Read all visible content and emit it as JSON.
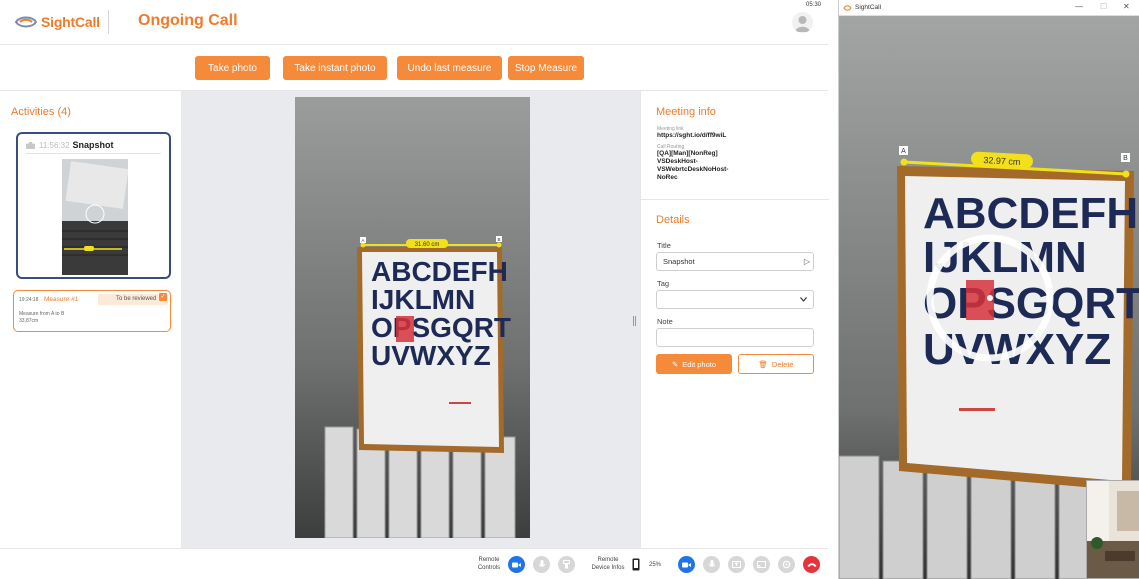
{
  "header": {
    "brand": "SightCall",
    "title": "Ongoing Call",
    "clock": "05:30"
  },
  "actions": {
    "take_photo": "Take photo",
    "take_instant_photo": "Take instant photo",
    "undo_last_measure": "Undo last measure",
    "stop_measure": "Stop Measure"
  },
  "activities": {
    "title": "Activities (4)",
    "snapshot": {
      "time": "11:56:32",
      "label": "Snapshot"
    },
    "measure": {
      "time": "19:24:18",
      "label": "Measure #1",
      "status": "To be reviewed",
      "description": "Measure from A to B",
      "value": "33,87cm"
    }
  },
  "photo": {
    "measure_label": "31.60 cm",
    "point_a": "A",
    "point_b": "B",
    "poster_lines": [
      "ABCDEFH",
      "IJKLMN",
      "OPSGQRT",
      "UVWXYZ"
    ]
  },
  "meeting_info": {
    "title": "Meeting info",
    "meeting_link_label": "Meeting link",
    "meeting_link": "https://sght.io/d/ff9wiL",
    "call_routing_label": "Call Routing",
    "call_routing_lines": [
      "[QA][Man][NonReg]",
      "VSDeskHost-",
      "VSWebrtcDeskNoHost-",
      "NoRec"
    ]
  },
  "details": {
    "title": "Details",
    "title_label": "Title",
    "title_value": "Snapshot",
    "tag_label": "Tag",
    "tag_value": "",
    "note_label": "Note",
    "note_value": "",
    "edit_button": "Edit photo",
    "delete_button": "Delete"
  },
  "bottom_bar": {
    "remote_controls": "Remote Controls",
    "remote_device_infos": "Remote Device Infos",
    "battery": "25%"
  },
  "remote_window": {
    "title": "SightCall",
    "measure_label": "32.97 cm",
    "point_a": "A",
    "point_b": "B",
    "poster_lines": [
      "ABCDEFH",
      "IJKLMN",
      "OPSGQRT",
      "UVWXYZ"
    ]
  },
  "colors": {
    "accent": "#f58a3a",
    "title_orange": "#f07b2b",
    "card_border": "#3a4c80",
    "call_blue": "#1e74e8",
    "hangup_red": "#e6343f",
    "measure_yellow": "#f2e11a",
    "poster_blue": "#1d2a55",
    "poster_red": "#d6333a"
  }
}
